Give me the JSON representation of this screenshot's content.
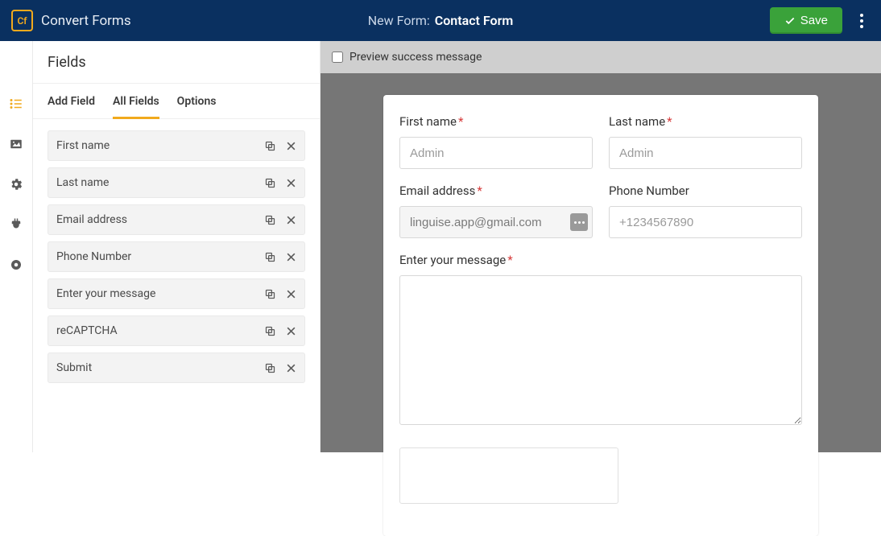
{
  "brand": {
    "logo": "Cf",
    "name": "Convert Forms"
  },
  "header": {
    "prefix": "New Form:",
    "name": "Contact Form",
    "save": "Save"
  },
  "panel": {
    "title": "Fields"
  },
  "tabs": {
    "add": "Add Field",
    "all": "All Fields",
    "options": "Options"
  },
  "fields": [
    {
      "label": "First name"
    },
    {
      "label": "Last name"
    },
    {
      "label": "Email address"
    },
    {
      "label": "Phone Number"
    },
    {
      "label": "Enter your message"
    },
    {
      "label": "reCAPTCHA"
    },
    {
      "label": "Submit"
    }
  ],
  "toolbar": {
    "preview": "Preview success message"
  },
  "form": {
    "first": {
      "label": "First name",
      "placeholder": "Admin"
    },
    "last": {
      "label": "Last name",
      "placeholder": "Admin"
    },
    "email": {
      "label": "Email address",
      "value": "linguise.app@gmail.com"
    },
    "phone": {
      "label": "Phone Number",
      "placeholder": "+1234567890"
    },
    "message": {
      "label": "Enter your message"
    }
  }
}
